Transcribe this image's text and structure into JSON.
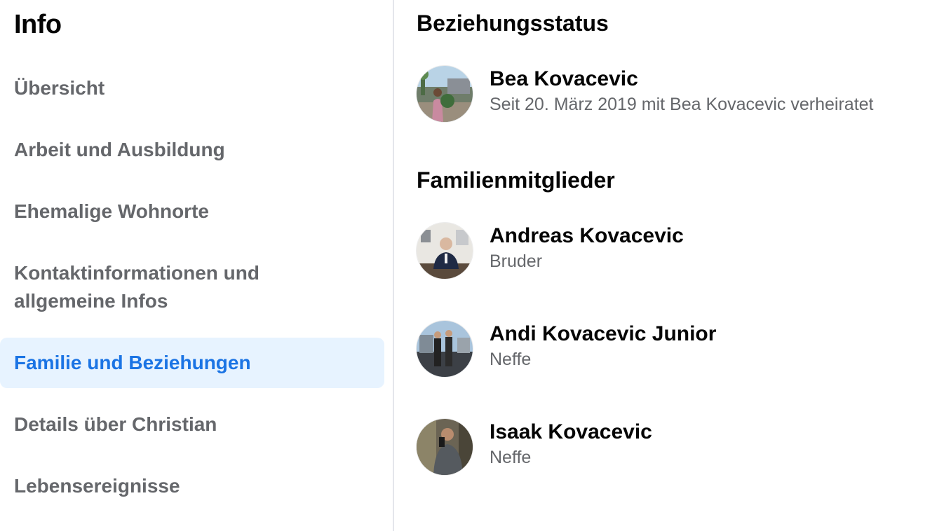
{
  "sidebar": {
    "title": "Info",
    "items": [
      {
        "label": "Übersicht"
      },
      {
        "label": "Arbeit und Ausbildung"
      },
      {
        "label": "Ehemalige Wohnorte"
      },
      {
        "label": "Kontaktinformationen und",
        "label2": "allgemeine Infos"
      },
      {
        "label": "Familie und Beziehungen",
        "active": true
      },
      {
        "label": "Details über Christian"
      },
      {
        "label": "Lebensereignisse"
      }
    ]
  },
  "relationship": {
    "title": "Beziehungsstatus",
    "person": {
      "name": "Bea Kovacevic",
      "detail": "Seit 20. März 2019 mit Bea Kovacevic verheiratet"
    }
  },
  "family": {
    "title": "Familienmitglieder",
    "members": [
      {
        "name": "Andreas Kovacevic",
        "relation": "Bruder"
      },
      {
        "name": "Andi Kovacevic Junior",
        "relation": "Neffe"
      },
      {
        "name": "Isaak Kovacevic",
        "relation": "Neffe"
      }
    ]
  },
  "colors": {
    "active_bg": "#e7f3ff",
    "active_text": "#1b74e4",
    "secondary_text": "#65676b",
    "primary_text": "#050505"
  }
}
